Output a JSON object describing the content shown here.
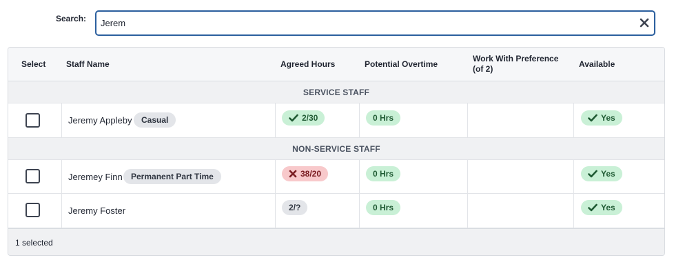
{
  "search": {
    "label": "Search:",
    "value": "Jerem",
    "placeholder": ""
  },
  "columns": {
    "select": "Select",
    "staff_name": "Staff Name",
    "agreed_hours": "Agreed Hours",
    "potential_overtime": "Potential Overtime",
    "work_with_preference_line1": "Work With Preference",
    "work_with_preference_line2": "(of 2)",
    "available": "Available"
  },
  "groups": [
    {
      "title": "SERVICE STAFF",
      "rows": [
        {
          "name": "Jeremy Appleby",
          "tag": "Casual",
          "agreed_hours": "2/30",
          "agreed_status": "ok",
          "overtime": "0 Hrs",
          "work_pref": "",
          "available": "Yes",
          "selected": false
        }
      ]
    },
    {
      "title": "NON-SERVICE STAFF",
      "rows": [
        {
          "name": "Jeremey Finn",
          "tag": "Permanent Part Time",
          "agreed_hours": "38/20",
          "agreed_status": "over",
          "overtime": "0 Hrs",
          "work_pref": "",
          "available": "Yes",
          "selected": false
        },
        {
          "name": "Jeremy Foster",
          "tag": "",
          "agreed_hours": "2/?",
          "agreed_status": "unknown",
          "overtime": "0 Hrs",
          "work_pref": "",
          "available": "Yes",
          "selected": false
        }
      ]
    }
  ],
  "footer": {
    "selected_text": "1 selected"
  },
  "colors": {
    "focus_border": "#2b5f9e",
    "pill_green": "#c9f0d6",
    "pill_red": "#f8c9cb",
    "pill_gray": "#e3e5e9"
  },
  "icons": {
    "clear": "close-icon",
    "ok": "check-icon",
    "over": "x-icon"
  }
}
